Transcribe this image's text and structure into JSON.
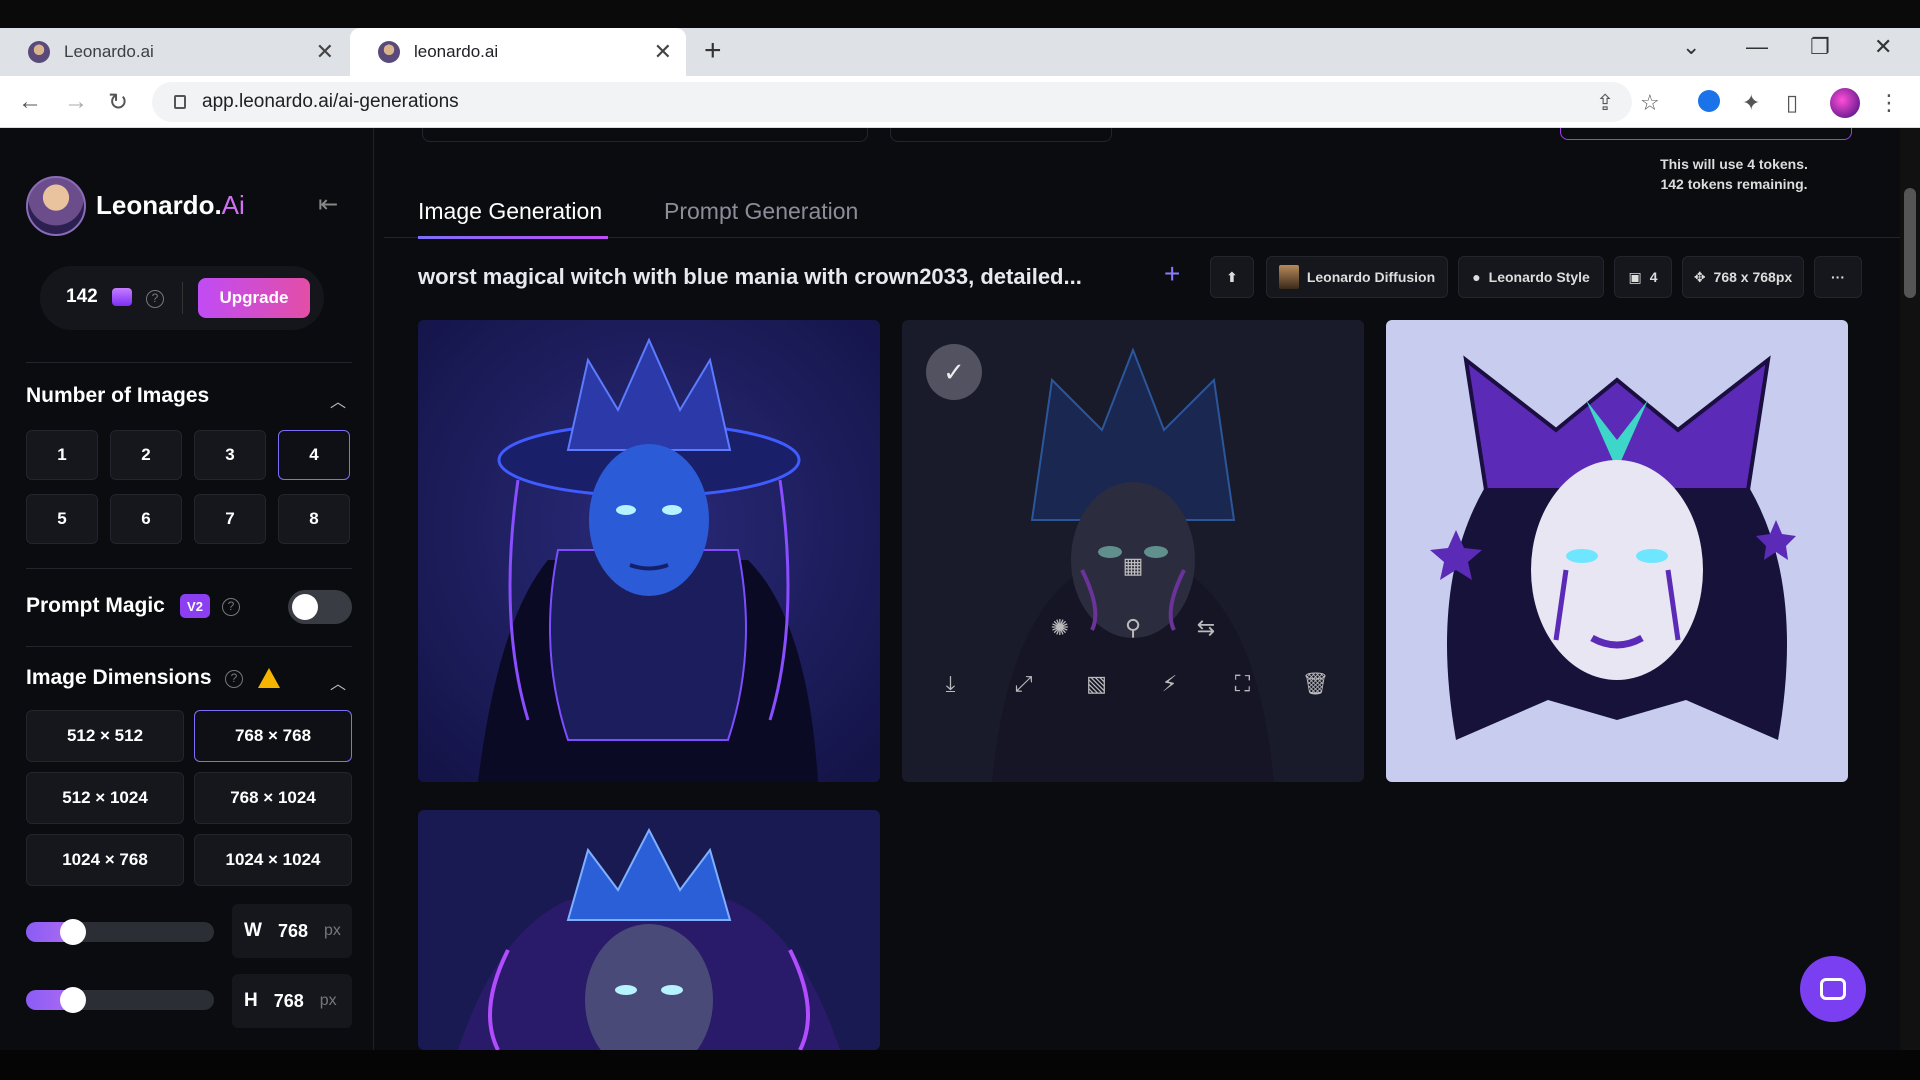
{
  "browser": {
    "tabs": [
      {
        "title": "Leonardo.ai",
        "active": false
      },
      {
        "title": "leonardo.ai",
        "active": true
      }
    ],
    "url": "app.leonardo.ai/ai-generations"
  },
  "sidebar": {
    "brand_main": "Leonardo.",
    "brand_accent": "Ai",
    "tokens": "142",
    "upgrade_label": "Upgrade",
    "number_of_images_title": "Number of Images",
    "number_options": [
      "1",
      "2",
      "3",
      "4",
      "5",
      "6",
      "7",
      "8"
    ],
    "number_selected": "4",
    "prompt_magic_title": "Prompt Magic",
    "prompt_magic_badge": "V2",
    "prompt_magic_enabled": false,
    "image_dimensions_title": "Image Dimensions",
    "dimension_options": [
      "512 × 512",
      "768 × 768",
      "512 × 1024",
      "768 × 1024",
      "1024 × 768",
      "1024 × 1024"
    ],
    "dimension_selected": "768 × 768",
    "width_label": "W",
    "width_value": "768",
    "height_label": "H",
    "height_value": "768",
    "unit": "px"
  },
  "main": {
    "token_note_line1": "This will use 4 tokens.",
    "token_note_line2": "142 tokens remaining.",
    "tabs": [
      {
        "label": "Image Generation",
        "active": true
      },
      {
        "label": "Prompt Generation",
        "active": false
      }
    ],
    "prompt": "worst magical witch with blue mania with crown2033, detailed...",
    "chips": {
      "model": "Leonardo Diffusion",
      "style": "Leonardo Style",
      "count": "4",
      "size": "768 x 768px"
    }
  },
  "colors": {
    "accent": "#7d6ff7",
    "upgrade": "#c04cf5",
    "background": "#0b0c0f"
  }
}
